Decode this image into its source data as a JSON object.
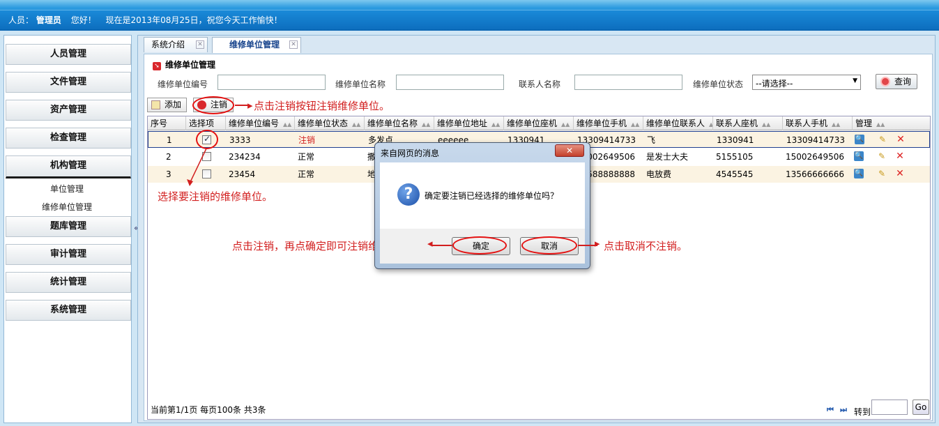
{
  "header": {
    "user_label": "人员：",
    "user_name": "管理员",
    "greeting": "您好！",
    "date_text": "现在是2013年08月25日，祝您今天工作愉快！"
  },
  "sidebar": {
    "items": [
      {
        "label": "人员管理"
      },
      {
        "label": "文件管理"
      },
      {
        "label": "资产管理"
      },
      {
        "label": "检查管理"
      },
      {
        "label": "机构管理"
      },
      {
        "label": "题库管理"
      },
      {
        "label": "审计管理"
      },
      {
        "label": "统计管理"
      },
      {
        "label": "系统管理"
      }
    ],
    "sub_items": [
      {
        "label": "单位管理"
      },
      {
        "label": "维修单位管理"
      }
    ],
    "collapse_glyph": "«"
  },
  "tabs": [
    {
      "label": "系统介绍"
    },
    {
      "label": "维修单位管理"
    }
  ],
  "section": {
    "title": "维修单位管理"
  },
  "filters": {
    "code_label": "维修单位编号",
    "name_label": "维修单位名称",
    "contact_label": "联系人名称",
    "status_label": "维修单位状态",
    "status_value": "--请选择--",
    "query_label": "查询"
  },
  "toolbar": {
    "add_label": "添加",
    "cancel_label": "注销"
  },
  "annotations": {
    "cancel_hint": "点击注销按钮注销维修单位。",
    "select_hint": "选择要注销的维修单位。",
    "confirm_hint": "点击注销，再点确定即可注销维修单位。",
    "cancel_dialog_hint": "点击取消不注销。"
  },
  "table": {
    "columns": [
      "序号",
      "选择项",
      "维修单位编号",
      "维修单位状态",
      "维修单位名称",
      "维修单位地址",
      "维修单位座机",
      "维修单位手机",
      "维修单位联系人",
      "联系人座机",
      "联系人手机",
      "管理"
    ],
    "rows": [
      {
        "no": "1",
        "checked": true,
        "code": "3333",
        "status": "注销",
        "name": "多发点",
        "address": "eeeeee",
        "phone": "1330941",
        "mobile": "13309414733",
        "contact": "飞",
        "contact_phone": "1330941",
        "contact_mobile": "13309414733"
      },
      {
        "no": "2",
        "checked": false,
        "code": "234234",
        "status": "正常",
        "name": "撒",
        "address": "",
        "phone": "",
        "mobile": "15002649506",
        "contact": "是发士大夫",
        "contact_phone": "5155105",
        "contact_mobile": "15002649506"
      },
      {
        "no": "3",
        "checked": false,
        "code": "23454",
        "status": "正常",
        "name": "地",
        "address": "",
        "phone": "",
        "mobile": "13588888888",
        "contact": "电放费",
        "contact_phone": "4545545",
        "contact_mobile": "13566666666"
      }
    ]
  },
  "pager": {
    "info": "当前第1/1页  每页100条  共3条",
    "first": "⏮",
    "next": "⏭",
    "goto_label": "转到",
    "go_label": "Go"
  },
  "dialog": {
    "title": "来自网页的消息",
    "close": "✕",
    "icon": "?",
    "message": "确定要注销已经选择的维修单位吗？",
    "ok": "确定",
    "cancel": "取消"
  },
  "colors": {
    "annotation": "#d21f1f",
    "header_blue": "#0d6fbf"
  }
}
